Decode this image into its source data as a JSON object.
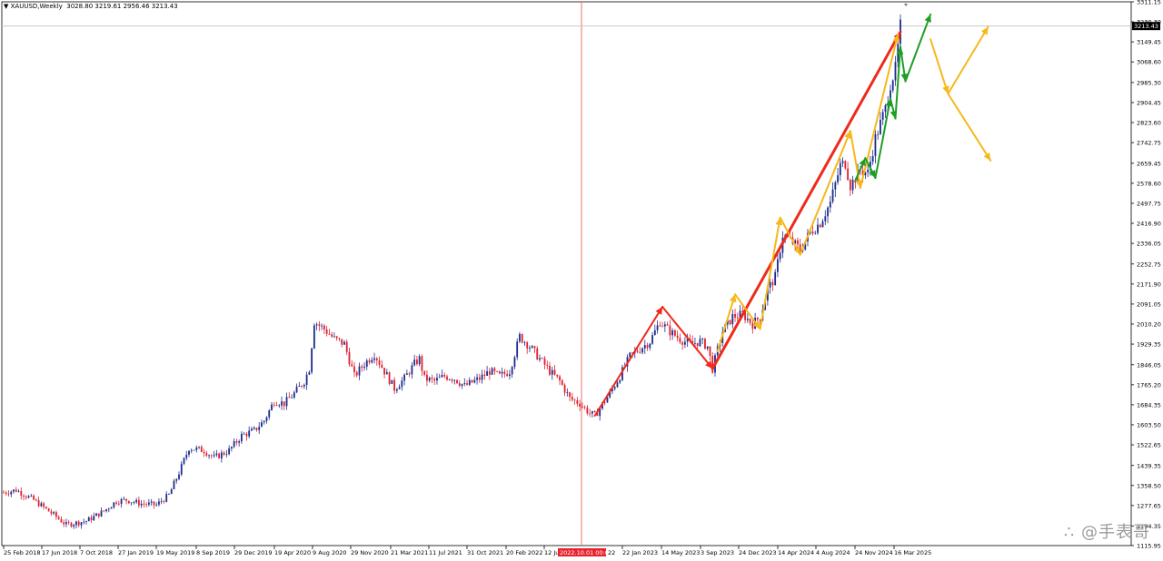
{
  "header": {
    "arrow": "▼",
    "symbol": "XAUUSD,Weekly",
    "ohlc": "3028.80 3219.61 2956.46 3213.43"
  },
  "watermark": "∴ @手表哥",
  "colors": {
    "bull": "#1c2c8c",
    "bear": "#e01f2f",
    "red": "#ef2a1a",
    "orange": "#f6b81a",
    "green": "#1f9e24",
    "vline": "#f07070",
    "hline": "#c8c8c8"
  },
  "chart_data": {
    "type": "candlestick",
    "ylim": [
      1115.95,
      3311.15
    ],
    "price_ticks": [
      "3311.15",
      "3230.30",
      "3149.45",
      "3068.60",
      "2985.30",
      "2904.45",
      "2823.60",
      "2742.75",
      "2659.45",
      "2578.60",
      "2497.75",
      "2416.90",
      "2336.05",
      "2252.75",
      "2171.90",
      "2091.05",
      "2010.20",
      "1929.35",
      "1846.05",
      "1765.20",
      "1684.35",
      "1603.50",
      "1522.65",
      "1439.35",
      "1358.50",
      "1277.65",
      "1194.35",
      "1115.95"
    ],
    "current_price": "3213.43",
    "date_ticks": [
      "25 Feb 2018",
      "17 Jun 2018",
      "7 Oct 2018",
      "27 Jan 2019",
      "19 May 2019",
      "8 Sep 2019",
      "29 Dec 2019",
      "19 Apr 2020",
      "9 Aug 2020",
      "29 Nov 2020",
      "21 Mar 2021",
      "11 Jul 2021",
      "31 Oct 2021",
      "20 Feb 2022",
      "12 Jun 2022",
      "22 Jan 2023",
      "14 May 2023",
      "3 Sep 2023",
      "24 Dec 2023",
      "14 Apr 2024",
      "4 Aug 2024",
      "24 Nov 2024",
      "16 Mar 2025"
    ],
    "crosshair_label": "2022.10.01 00:00",
    "hidden_tick_suffix": "22",
    "n_bars": 370,
    "anchors": [
      [
        0,
        1330
      ],
      [
        5,
        1340
      ],
      [
        12,
        1300
      ],
      [
        20,
        1240
      ],
      [
        25,
        1200
      ],
      [
        33,
        1215
      ],
      [
        40,
        1255
      ],
      [
        45,
        1295
      ],
      [
        49,
        1300
      ],
      [
        55,
        1285
      ],
      [
        61,
        1280
      ],
      [
        66,
        1320
      ],
      [
        70,
        1410
      ],
      [
        74,
        1510
      ],
      [
        80,
        1500
      ],
      [
        84,
        1470
      ],
      [
        90,
        1500
      ],
      [
        95,
        1560
      ],
      [
        100,
        1580
      ],
      [
        104,
        1620
      ],
      [
        108,
        1700
      ],
      [
        112,
        1690
      ],
      [
        116,
        1730
      ],
      [
        120,
        1780
      ],
      [
        122,
        1830
      ],
      [
        124,
        2020
      ],
      [
        128,
        1990
      ],
      [
        132,
        1950
      ],
      [
        136,
        1930
      ],
      [
        140,
        1800
      ],
      [
        144,
        1850
      ],
      [
        148,
        1890
      ],
      [
        152,
        1820
      ],
      [
        156,
        1750
      ],
      [
        160,
        1790
      ],
      [
        164,
        1850
      ],
      [
        166,
        1870
      ],
      [
        168,
        1790
      ],
      [
        172,
        1780
      ],
      [
        176,
        1800
      ],
      [
        180,
        1790
      ],
      [
        184,
        1760
      ],
      [
        190,
        1790
      ],
      [
        194,
        1820
      ],
      [
        198,
        1800
      ],
      [
        202,
        1820
      ],
      [
        206,
        1960
      ],
      [
        210,
        1920
      ],
      [
        214,
        1870
      ],
      [
        218,
        1820
      ],
      [
        222,
        1780
      ],
      [
        226,
        1710
      ],
      [
        230,
        1690
      ],
      [
        234,
        1650
      ],
      [
        236,
        1640
      ],
      [
        238,
        1670
      ],
      [
        242,
        1730
      ],
      [
        246,
        1800
      ],
      [
        250,
        1880
      ],
      [
        254,
        1910
      ],
      [
        258,
        1940
      ],
      [
        262,
        2020
      ],
      [
        266,
        1980
      ],
      [
        270,
        1950
      ],
      [
        274,
        1930
      ],
      [
        278,
        1940
      ],
      [
        281,
        1920
      ],
      [
        283,
        1830
      ],
      [
        287,
        1980
      ],
      [
        291,
        2040
      ],
      [
        295,
        2050
      ],
      [
        299,
        2010
      ],
      [
        302,
        2040
      ],
      [
        305,
        2150
      ],
      [
        308,
        2200
      ],
      [
        311,
        2370
      ],
      [
        315,
        2340
      ],
      [
        318,
        2310
      ],
      [
        322,
        2380
      ],
      [
        326,
        2420
      ],
      [
        330,
        2500
      ],
      [
        334,
        2650
      ],
      [
        336,
        2660
      ],
      [
        338,
        2570
      ],
      [
        342,
        2630
      ],
      [
        345,
        2620
      ],
      [
        348,
        2760
      ],
      [
        350,
        2820
      ],
      [
        352,
        2880
      ],
      [
        354,
        2980
      ],
      [
        356,
        3040
      ],
      [
        358,
        3213
      ]
    ],
    "red_arrows": [
      [
        236,
        1640,
        263,
        2080
      ],
      [
        263,
        2080,
        283,
        1830
      ],
      [
        283,
        1830,
        358,
        3190
      ]
    ],
    "orange_arrows": [
      [
        285,
        1900,
        292,
        2130
      ],
      [
        292,
        2130,
        302,
        1990
      ],
      [
        302,
        1990,
        310,
        2440
      ],
      [
        310,
        2440,
        318,
        2290
      ],
      [
        318,
        2290,
        338,
        2790
      ],
      [
        338,
        2790,
        342,
        2560
      ],
      [
        342,
        2560,
        357,
        3180
      ],
      [
        370,
        3160,
        377,
        2940
      ],
      [
        377,
        2940,
        393,
        3210
      ],
      [
        377,
        2940,
        394,
        2670
      ]
    ],
    "green_arrows": [
      [
        340,
        2590,
        344,
        2680
      ],
      [
        344,
        2680,
        348,
        2600
      ],
      [
        348,
        2600,
        354,
        2920
      ],
      [
        354,
        2920,
        356,
        2840
      ],
      [
        356,
        2840,
        358,
        3130
      ],
      [
        358,
        3130,
        360,
        2990
      ],
      [
        360,
        2990,
        370,
        3260
      ]
    ]
  }
}
